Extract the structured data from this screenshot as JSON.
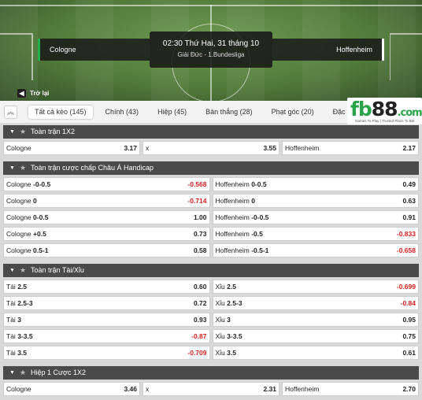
{
  "match": {
    "home_team": "Cologne",
    "away_team": "Hoffenheim",
    "datetime": "02:30 Thứ Hai, 31 tháng 10",
    "league": "Giải Đức - 1.Bundesliga"
  },
  "back_label": "Trở lại",
  "tabs": [
    {
      "label": "Tất cả kèo (145)",
      "active": true
    },
    {
      "label": "Chính (43)"
    },
    {
      "label": "Hiệp (45)"
    },
    {
      "label": "Bàn thắng (28)"
    },
    {
      "label": "Phạt góc (20)"
    },
    {
      "label": "Đặc biệt (13)"
    }
  ],
  "logo": {
    "brand": "fb88.com",
    "tagline": "Games To Play | Trusted Place To Bet"
  },
  "sections": [
    {
      "title": "Toàn trận 1X2",
      "rows": [
        [
          {
            "label": "Cologne",
            "value": "3.17"
          },
          {
            "label": "x",
            "value": "3.55"
          },
          {
            "label": "Hoffenheim",
            "value": "2.17"
          }
        ]
      ]
    },
    {
      "title": "Toàn trận cược chấp Châu Á Handicap",
      "rows": [
        [
          {
            "label": "Cologne",
            "line": "-0-0.5",
            "value": "-0.568",
            "neg": true
          },
          {
            "label": "Hoffenheim",
            "line": "0-0.5",
            "value": "0.49"
          }
        ],
        [
          {
            "label": "Cologne",
            "line": "0",
            "value": "-0.714",
            "neg": true
          },
          {
            "label": "Hoffenheim",
            "line": "0",
            "value": "0.63"
          }
        ],
        [
          {
            "label": "Cologne",
            "line": "0-0.5",
            "value": "1.00"
          },
          {
            "label": "Hoffenheim",
            "line": "-0-0.5",
            "value": "0.91"
          }
        ],
        [
          {
            "label": "Cologne",
            "line": "+0.5",
            "value": "0.73"
          },
          {
            "label": "Hoffenheim",
            "line": "-0.5",
            "value": "-0.833",
            "neg": true
          }
        ],
        [
          {
            "label": "Cologne",
            "line": "0.5-1",
            "value": "0.58"
          },
          {
            "label": "Hoffenheim",
            "line": "-0.5-1",
            "value": "-0.658",
            "neg": true
          }
        ]
      ]
    },
    {
      "title": "Toàn trận Tài/Xỉu",
      "rows": [
        [
          {
            "label": "Tài",
            "line": "2.5",
            "value": "0.60"
          },
          {
            "label": "Xỉu",
            "line": "2.5",
            "value": "-0.699",
            "neg": true
          }
        ],
        [
          {
            "label": "Tài",
            "line": "2.5-3",
            "value": "0.72"
          },
          {
            "label": "Xỉu",
            "line": "2.5-3",
            "value": "-0.84",
            "neg": true
          }
        ],
        [
          {
            "label": "Tài",
            "line": "3",
            "value": "0.93"
          },
          {
            "label": "Xỉu",
            "line": "3",
            "value": "0.95"
          }
        ],
        [
          {
            "label": "Tài",
            "line": "3-3.5",
            "value": "-0.87",
            "neg": true
          },
          {
            "label": "Xỉu",
            "line": "3-3.5",
            "value": "0.75"
          }
        ],
        [
          {
            "label": "Tài",
            "line": "3.5",
            "value": "-0.709",
            "neg": true
          },
          {
            "label": "Xỉu",
            "line": "3.5",
            "value": "0.61"
          }
        ]
      ]
    },
    {
      "title": "Hiệp 1 Cược 1X2",
      "rows": [
        [
          {
            "label": "Cologne",
            "value": "3.46"
          },
          {
            "label": "x",
            "value": "2.31"
          },
          {
            "label": "Hoffenheim",
            "value": "2.70"
          }
        ]
      ]
    }
  ]
}
